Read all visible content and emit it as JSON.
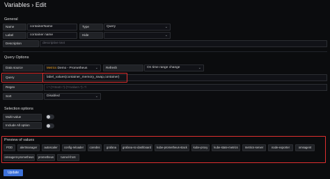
{
  "breadcrumb": {
    "title": "Variables › Edit"
  },
  "sections": {
    "general": "General",
    "query_options": "Query Options",
    "selection": "Selection options",
    "preview": "Preview of values"
  },
  "general": {
    "name_label": "Name",
    "name_value": "containerName",
    "type_label": "Type",
    "type_value": "Query",
    "label_label": "Label",
    "label_value": "container name",
    "hide_label": "Hide",
    "hide_value": "",
    "description_label": "Description",
    "description_placeholder": "descriptive text"
  },
  "query_options": {
    "datasource_label": "Data source",
    "datasource_prefix": "Metrics",
    "datasource_value": "Demo - Prometheus",
    "refresh_label": "Refresh",
    "refresh_value": "On time range change",
    "query_label": "Query",
    "query_value": "label_values(container_memory_swap,container)",
    "regex_label": "Regex",
    "regex_placeholder": "/.*-(?<text>.*)-(?<value>.*)-.*/",
    "sort_label": "Sort",
    "sort_value": "Disabled"
  },
  "selection": {
    "multi_label": "Multi-value",
    "include_all_label": "Include All option",
    "multi_enabled": false,
    "include_all_enabled": false
  },
  "preview_values": [
    "POD",
    "alertmanager",
    "autoscaler",
    "config-reloader",
    "coredns",
    "grafana",
    "grafana-sc-dashboard",
    "kube-prometheus-stack",
    "kube-proxy",
    "kube-state-metrics",
    "metrics-server",
    "node-exporter",
    "omsagent",
    "omsagent-prometheus",
    "prometheus",
    "tunnel-front"
  ],
  "update_button": "Update",
  "accent": "#3d71d9",
  "highlight": "#e02f2f"
}
